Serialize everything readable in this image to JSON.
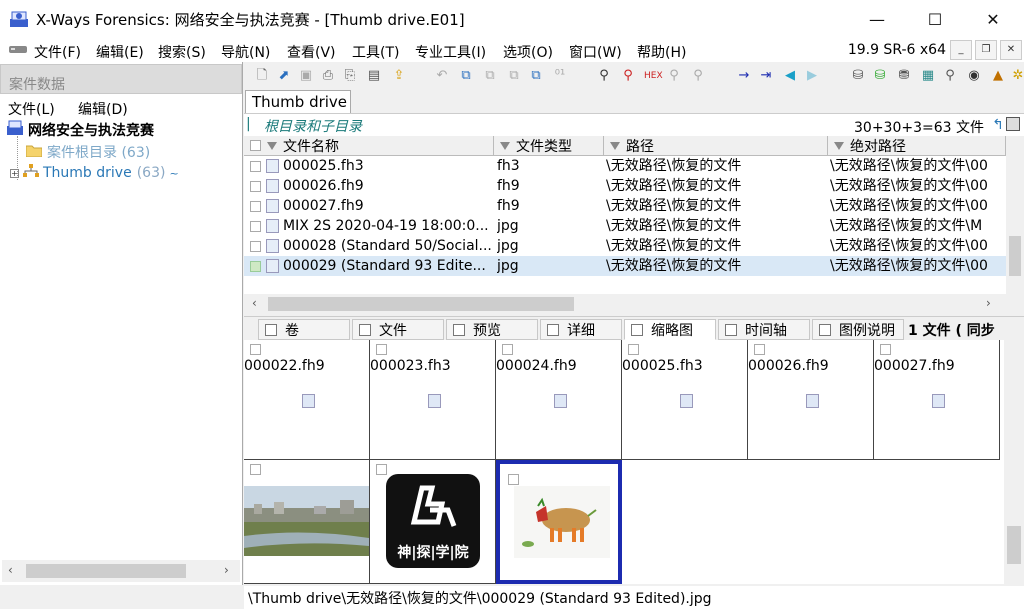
{
  "window": {
    "title": "X-Ways Forensics: 网络安全与执法竞赛 - [Thumb drive.E01]",
    "min_label": "—",
    "max_label": "☐",
    "close_label": "✕"
  },
  "menu": {
    "items": [
      "文件(F)",
      "编辑(E)",
      "搜索(S)",
      "导航(N)",
      "查看(V)",
      "工具(T)",
      "专业工具(I)",
      "选项(O)",
      "窗口(W)",
      "帮助(H)"
    ],
    "version": "19.9 SR-6 x64"
  },
  "left_pane": {
    "header": "案件数据",
    "menu": [
      "文件(L)",
      "编辑(D)"
    ],
    "tree": {
      "root": "网络安全与执法竞赛",
      "child_root_dir": "案件根目录 (63)",
      "child_drive": "Thumb drive",
      "child_drive_count": "(63)"
    }
  },
  "doc_tab": "Thumb drive",
  "path_bar": {
    "label": "根目录和子目录",
    "count": "30+30+3=63 文件"
  },
  "table": {
    "headers": [
      "文件名称",
      "文件类型",
      "路径",
      "绝对路径"
    ],
    "rows": [
      {
        "name": "000025.fh3",
        "type": "fh3",
        "path": "\\无效路径\\恢复的文件",
        "abs": "\\无效路径\\恢复的文件\\00"
      },
      {
        "name": "000026.fh9",
        "type": "fh9",
        "path": "\\无效路径\\恢复的文件",
        "abs": "\\无效路径\\恢复的文件\\00"
      },
      {
        "name": "000027.fh9",
        "type": "fh9",
        "path": "\\无效路径\\恢复的文件",
        "abs": "\\无效路径\\恢复的文件\\00"
      },
      {
        "name": "MIX 2S 2020-04-19 18:00:0...",
        "type": "jpg",
        "path": "\\无效路径\\恢复的文件",
        "abs": "\\无效路径\\恢复的文件\\M"
      },
      {
        "name": "000028 (Standard 50/Social...",
        "type": "jpg",
        "path": "\\无效路径\\恢复的文件",
        "abs": "\\无效路径\\恢复的文件\\00"
      },
      {
        "name": "000029 (Standard 93 Edite...",
        "type": "jpg",
        "path": "\\无效路径\\恢复的文件",
        "abs": "\\无效路径\\恢复的文件\\00"
      }
    ]
  },
  "view_tabs": [
    "卷",
    "文件",
    "预览",
    "详细",
    "缩略图",
    "时间轴",
    "图例说明"
  ],
  "view_tab_extra": "1 文件 ( 同步",
  "gallery": {
    "names": [
      "000022.fh9",
      "000023.fh3",
      "000024.fh9",
      "000025.fh3",
      "000026.fh9",
      "000027.fh9"
    ],
    "logo_text": "神|探|学|院"
  },
  "status": "\\Thumb drive\\无效路径\\恢复的文件\\000029 (Standard 93 Edited).jpg",
  "colors": {
    "selection": "#d9e8f6",
    "accent_blue": "#1c2bb0",
    "tree_link": "#2a78b6"
  }
}
